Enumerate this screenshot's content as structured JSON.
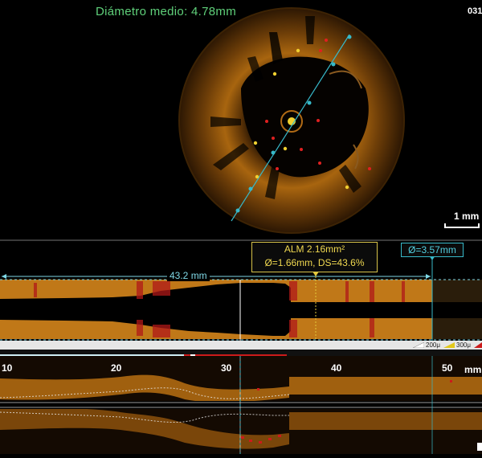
{
  "cross_section": {
    "mean_diameter": "Diámetro medio:  4.78mm",
    "frame_number": "031",
    "scale_label": "1 mm"
  },
  "longitudinal": {
    "alm": {
      "title": "ALM 2.16mm²",
      "detail": "Ø=1.66mm, DS=43.6%"
    },
    "reference_diameter": "Ø=3.57mm",
    "lesion_length": "43.2 mm"
  },
  "legend": {
    "items": [
      {
        "label": "200μ",
        "color": "#ffffff"
      },
      {
        "label": "300μ",
        "color": "#e2c81a"
      },
      {
        "label": "",
        "color": "#cc1b1b"
      }
    ]
  },
  "bottom_axis": {
    "ticks": [
      "10",
      "20",
      "30",
      "40",
      "50"
    ],
    "unit": "mm"
  },
  "colors": {
    "tissue": "#c07818",
    "lumen_marker": "#37b9c9",
    "alm_marker": "#e5c83a",
    "stent_strut": "#cc1b1b",
    "mean_diameter_text": "#5fd07a"
  }
}
